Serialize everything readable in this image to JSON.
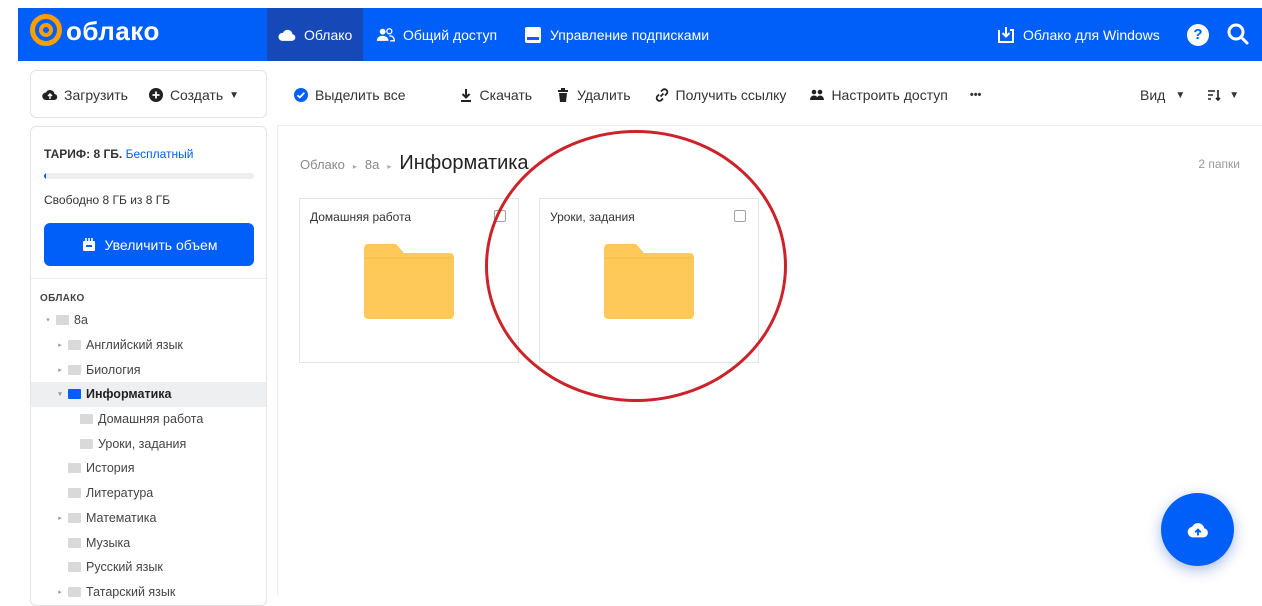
{
  "header": {
    "logo_text": "облако",
    "nav": [
      {
        "label": "Облако",
        "icon": "cloud-icon"
      },
      {
        "label": "Общий доступ",
        "icon": "users-icon"
      },
      {
        "label": "Управление подписками",
        "icon": "subscription-icon"
      }
    ],
    "windows_app_label": "Облако для Windows",
    "help_icon": "help-icon",
    "search_icon": "search-icon"
  },
  "toolbar": {
    "upload_label": "Загрузить",
    "create_label": "Создать",
    "select_all_label": "Выделить все",
    "download_label": "Скачать",
    "delete_label": "Удалить",
    "get_link_label": "Получить ссылку",
    "access_label": "Настроить доступ",
    "more_label": "•••",
    "view_label": "Вид"
  },
  "sidebar": {
    "tariff_prefix": "ТАРИФ: 8 ГБ.",
    "tariff_name": "Бесплатный",
    "usage_fraction": 0.01,
    "free_space": "Свободно 8 ГБ из 8 ГБ",
    "increase_label": "Увеличить объем",
    "tree_title": "ОБЛАКО",
    "tree": [
      {
        "label": "8а",
        "level": 0,
        "arrow": "▾"
      },
      {
        "label": "Английский язык",
        "level": 1,
        "arrow": "▸"
      },
      {
        "label": "Биология",
        "level": 1,
        "arrow": "▸"
      },
      {
        "label": "Информатика",
        "level": 1,
        "arrow": "▾",
        "active": true
      },
      {
        "label": "Домашняя работа",
        "level": 2,
        "arrow": ""
      },
      {
        "label": "Уроки, задания",
        "level": 2,
        "arrow": ""
      },
      {
        "label": "История",
        "level": 1,
        "arrow": ""
      },
      {
        "label": "Литература",
        "level": 1,
        "arrow": ""
      },
      {
        "label": "Математика",
        "level": 1,
        "arrow": "▸"
      },
      {
        "label": "Музыка",
        "level": 1,
        "arrow": ""
      },
      {
        "label": "Русский язык",
        "level": 1,
        "arrow": ""
      },
      {
        "label": "Татарский язык",
        "level": 1,
        "arrow": "▸"
      }
    ]
  },
  "main": {
    "breadcrumb": [
      "Облако",
      "8а"
    ],
    "current_folder": "Информатика",
    "count_label": "2 папки",
    "folders": [
      {
        "name": "Домашняя работа"
      },
      {
        "name": "Уроки, задания"
      }
    ]
  },
  "colors": {
    "brand_blue": "#005ff9",
    "folder_yellow": "#ffc95a",
    "annotation_red": "#cc2229"
  }
}
